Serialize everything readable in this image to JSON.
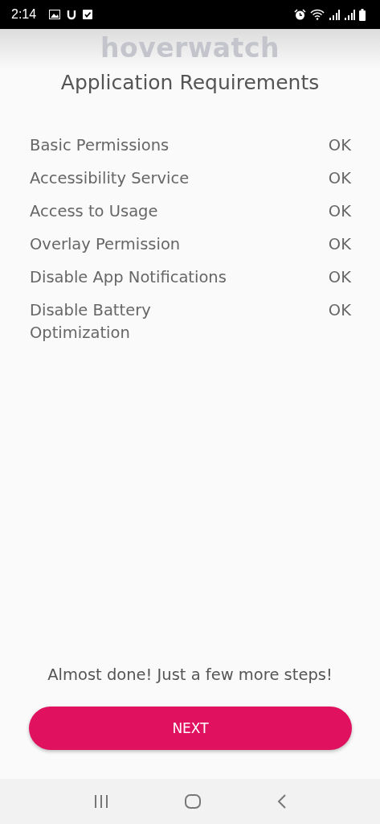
{
  "status_bar": {
    "time": "2:14"
  },
  "logo": "hoverwatch",
  "title": "Application Requirements",
  "requirements": [
    {
      "name": "Basic Permissions",
      "status": "OK"
    },
    {
      "name": "Accessibility Service",
      "status": "OK"
    },
    {
      "name": "Access to Usage",
      "status": "OK"
    },
    {
      "name": "Overlay Permission",
      "status": "OK"
    },
    {
      "name": "Disable App Notifications",
      "status": "OK"
    },
    {
      "name": "Disable Battery Optimization",
      "status": "OK"
    }
  ],
  "message": "Almost done! Just a few more steps!",
  "button": "NEXT"
}
